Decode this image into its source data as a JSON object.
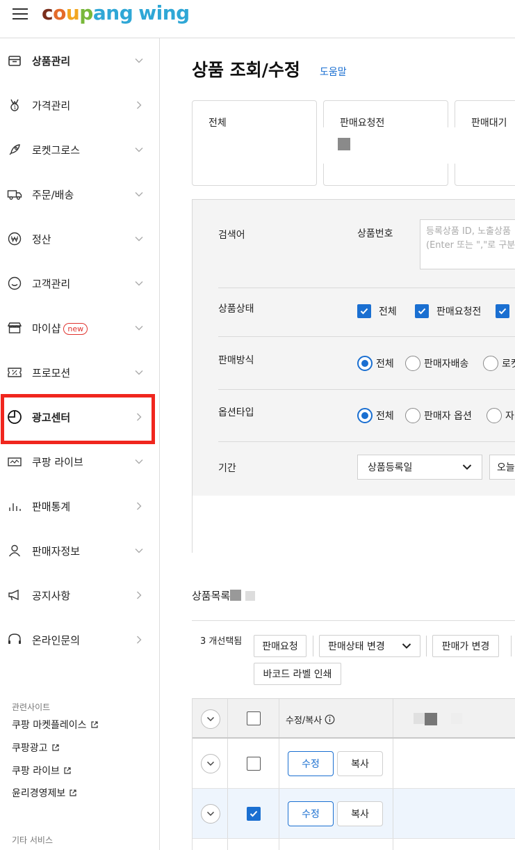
{
  "header": {
    "logo_letters": [
      "c",
      "o",
      "u",
      "p",
      "a",
      "n",
      "g"
    ],
    "logo_wing": "wing"
  },
  "sidebar": {
    "items": [
      {
        "label": "상품관리",
        "icon": "box-icon"
      },
      {
        "label": "가격관리",
        "icon": "medal-icon"
      },
      {
        "label": "로켓그로스",
        "icon": "rocket-icon"
      },
      {
        "label": "주문/배송",
        "icon": "truck-icon"
      },
      {
        "label": "정산",
        "icon": "won-icon"
      },
      {
        "label": "고객관리",
        "icon": "smile-icon"
      },
      {
        "label": "마이샵",
        "icon": "shop-icon",
        "badge": "new"
      },
      {
        "label": "프로모션",
        "icon": "coupon-icon"
      },
      {
        "label": "광고센터",
        "icon": "pie-icon"
      },
      {
        "label": "쿠팡 라이브",
        "icon": "live-icon"
      },
      {
        "label": "판매통계",
        "icon": "bar-chart-icon"
      },
      {
        "label": "판매자정보",
        "icon": "person-icon"
      },
      {
        "label": "공지사항",
        "icon": "megaphone-icon"
      },
      {
        "label": "온라인문의",
        "icon": "headset-icon"
      }
    ],
    "related_title": "관련사이트",
    "related_links": [
      "쿠팡 마켓플레이스",
      "쿠팡광고",
      "쿠팡 라이브",
      "윤리경영제보"
    ],
    "other_title": "기타 서비스"
  },
  "main": {
    "title": "상품 조회/수정",
    "help": "도움말",
    "stat_cards": [
      "전체",
      "판매요청전",
      "판매대기"
    ],
    "search": {
      "keyword_label": "검색어",
      "product_no_label": "상품번호",
      "product_no_placeholder": "등록상품 ID, 노출상품\n(Enter 또는 \",\"로 구분",
      "status_label": "상품상태",
      "status_options": [
        "전체",
        "판매요청전"
      ],
      "sales_method_label": "판매방식",
      "sales_method_options": [
        "전체",
        "판매자배송",
        "로켓"
      ],
      "option_type_label": "옵션타입",
      "option_type_options": [
        "전체",
        "판매자 옵션",
        "자"
      ],
      "period_label": "기간",
      "period_select": "상품등록일",
      "period_date": "오늘"
    },
    "list": {
      "title": "상품목록",
      "selected_count": "3 개선택됨",
      "buttons": {
        "request": "판매요청",
        "status_change": "판매상태 변경",
        "price_change": "판매가 변경",
        "barcode": "바코드 라벨 인쇄"
      },
      "col_edit_copy": "수정/복사",
      "edit_label": "수정",
      "copy_label": "복사"
    }
  },
  "colors": {
    "accent": "#1a6fd1",
    "highlight": "#f0261e"
  }
}
